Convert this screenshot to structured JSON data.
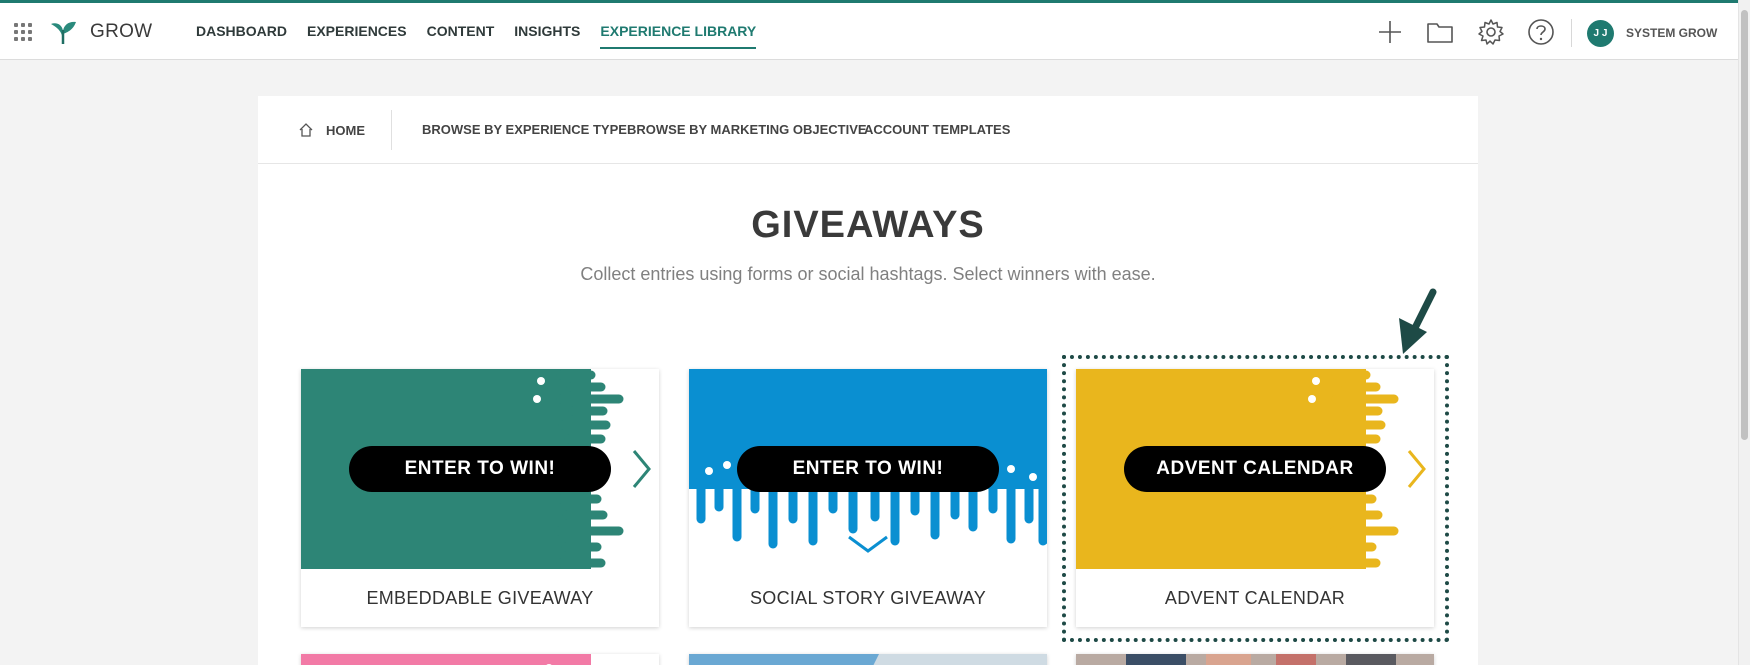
{
  "brand": {
    "name": "GROW"
  },
  "nav": {
    "items": [
      {
        "label": "DASHBOARD",
        "active": false
      },
      {
        "label": "EXPERIENCES",
        "active": false
      },
      {
        "label": "CONTENT",
        "active": false
      },
      {
        "label": "INSIGHTS",
        "active": false
      },
      {
        "label": "EXPERIENCE LIBRARY",
        "active": true
      }
    ]
  },
  "toolbar": {
    "icons": [
      "plus-icon",
      "folder-icon",
      "gear-icon",
      "help-icon"
    ],
    "avatar_initials": "J J",
    "user_name": "SYSTEM GROW"
  },
  "subnav": {
    "home": "HOME",
    "items": [
      "BROWSE BY EXPERIENCE TYPE",
      "BROWSE BY MARKETING OBJECTIVE",
      "ACCOUNT TEMPLATES"
    ]
  },
  "page": {
    "title": "GIVEAWAYS",
    "subtitle": "Collect entries using forms or social hashtags. Select winners with ease."
  },
  "cards": [
    {
      "art_label": "ENTER TO WIN!",
      "title": "EMBEDDABLE GIVEAWAY",
      "color": "#2d8576"
    },
    {
      "art_label": "ENTER TO WIN!",
      "title": "SOCIAL STORY GIVEAWAY",
      "color": "#0a8fd1"
    },
    {
      "art_label": "ADVENT CALENDAR",
      "title": "ADVENT CALENDAR",
      "color": "#e9b61d"
    }
  ],
  "colors": {
    "accent": "#1f7a70",
    "highlight": "#1e4a46"
  }
}
